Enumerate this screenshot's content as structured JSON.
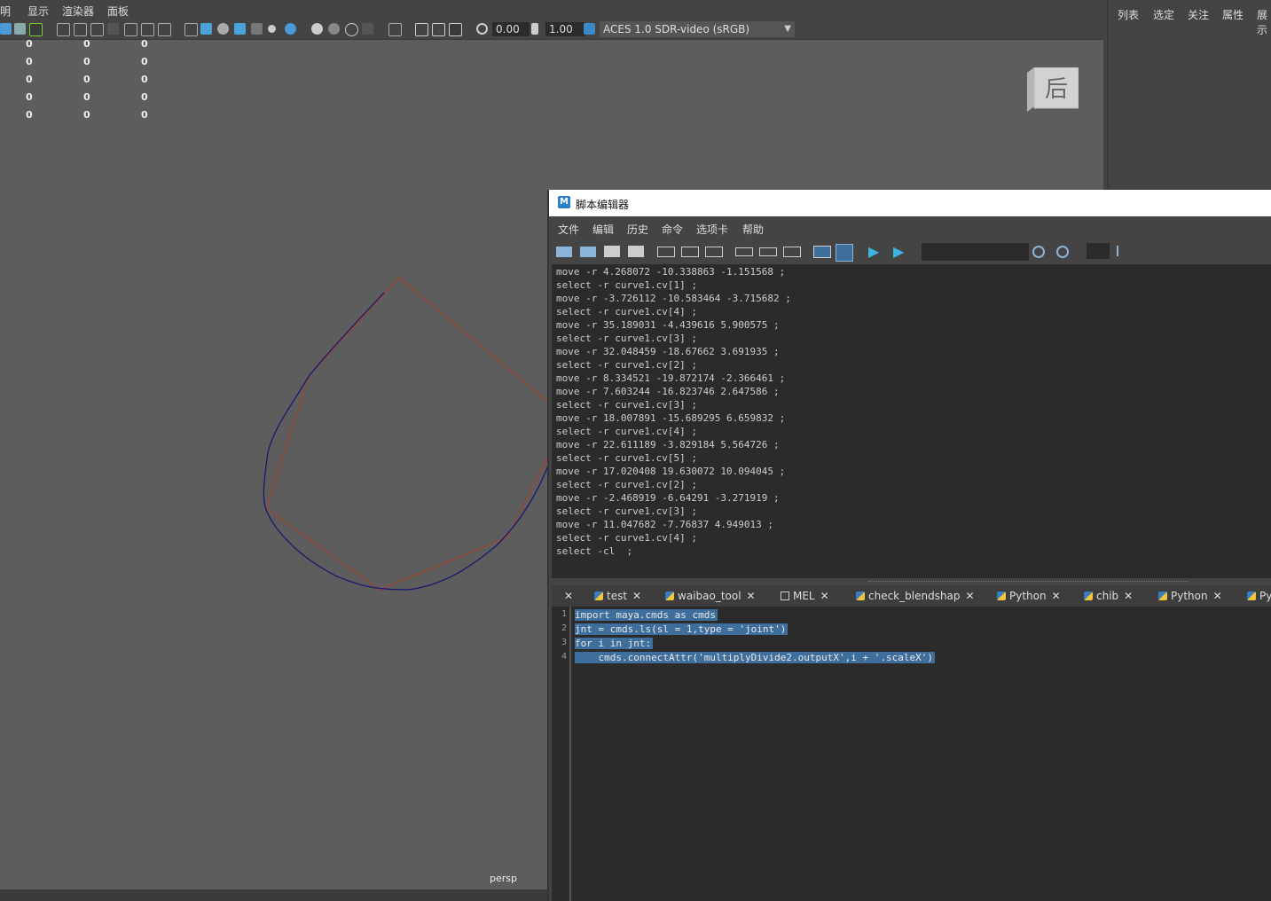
{
  "viewport": {
    "menubar": [
      "明",
      "显示",
      "渲染器",
      "面板"
    ],
    "toolbar": {
      "exposure": "0.00",
      "gamma": "1.00",
      "color_space": "ACES 1.0 SDR-video (sRGB)"
    },
    "hud_rows": [
      [
        "0",
        "0",
        "0"
      ],
      [
        "0",
        "0",
        "0"
      ],
      [
        "0",
        "0",
        "0"
      ],
      [
        "0",
        "0",
        "0"
      ],
      [
        "0",
        "0",
        "0"
      ]
    ],
    "viewcube_label": "后",
    "camera_label": "persp"
  },
  "right_panel": {
    "menu": [
      "列表",
      "选定",
      "关注",
      "属性",
      "展示"
    ]
  },
  "script_editor": {
    "title": "脚本编辑器",
    "menubar": [
      "文件",
      "编辑",
      "历史",
      "命令",
      "选项卡",
      "帮助"
    ],
    "history": [
      "move -r 4.268072 -10.338863 -1.151568 ;",
      "select -r curve1.cv[1] ;",
      "move -r -3.726112 -10.583464 -3.715682 ;",
      "select -r curve1.cv[4] ;",
      "move -r 35.189031 -4.439616 5.900575 ;",
      "select -r curve1.cv[3] ;",
      "move -r 32.048459 -18.67662 3.691935 ;",
      "select -r curve1.cv[2] ;",
      "move -r 8.334521 -19.872174 -2.366461 ;",
      "move -r 7.603244 -16.823746 2.647586 ;",
      "select -r curve1.cv[3] ;",
      "move -r 18.007891 -15.689295 6.659832 ;",
      "select -r curve1.cv[4] ;",
      "move -r 22.611189 -3.829184 5.564726 ;",
      "select -r curve1.cv[5] ;",
      "move -r 17.020408 19.630072 10.094045 ;",
      "select -r curve1.cv[2] ;",
      "move -r -2.468919 -6.64291 -3.271919 ;",
      "select -r curve1.cv[3] ;",
      "move -r 11.047682 -7.76837 4.949013 ;",
      "select -r curve1.cv[4] ;",
      "select -cl  ;"
    ],
    "tabs": [
      {
        "label": "",
        "icon": "none"
      },
      {
        "label": "test",
        "icon": "python"
      },
      {
        "label": "waibao_tool",
        "icon": "python"
      },
      {
        "label": "MEL",
        "icon": "mel"
      },
      {
        "label": "check_blendshap",
        "icon": "python"
      },
      {
        "label": "Python",
        "icon": "python"
      },
      {
        "label": "chib",
        "icon": "python"
      },
      {
        "label": "Python",
        "icon": "python"
      },
      {
        "label": "Py",
        "icon": "python"
      }
    ],
    "code": {
      "line_numbers": [
        "1",
        "2",
        "3",
        "4"
      ],
      "lines": [
        "import maya.cmds as cmds",
        "jnt = cmds.ls(sl = 1,type = 'joint')",
        "for i in jnt:",
        "    cmds.connectAttr('multiplyDivide2.outputX',i + '.scaleX')"
      ]
    }
  }
}
